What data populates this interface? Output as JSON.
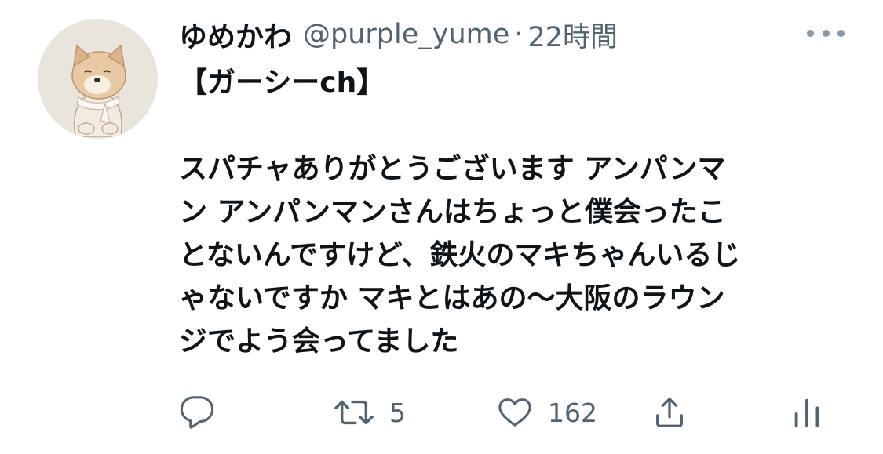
{
  "tweet": {
    "author": {
      "display_name": "ゆめかわ",
      "handle": "@purple_yume",
      "avatar_icon": "shiba-puppy-avatar"
    },
    "separator": "·",
    "timestamp": "22時間",
    "more_icon": "ellipsis-icon",
    "text_lines": [
      "【ガーシーch】",
      "",
      "スパチャありがとうございます アンパンマ",
      "ン アンパンマンさんはちょっと僕会ったこ",
      "とないんですけど、鉄火のマキちゃんいるじ",
      "ゃないですか マキとはあの〜大阪のラウン",
      "ジでよう会ってました"
    ],
    "actions": {
      "reply_icon": "reply-icon",
      "retweet_icon": "retweet-icon",
      "retweet_count": "5",
      "like_icon": "heart-icon",
      "like_count": "162",
      "share_icon": "share-icon",
      "analytics_icon": "analytics-icon"
    },
    "colors": {
      "text": "#0f1419",
      "secondary": "#536471",
      "icon": "#536471"
    }
  }
}
